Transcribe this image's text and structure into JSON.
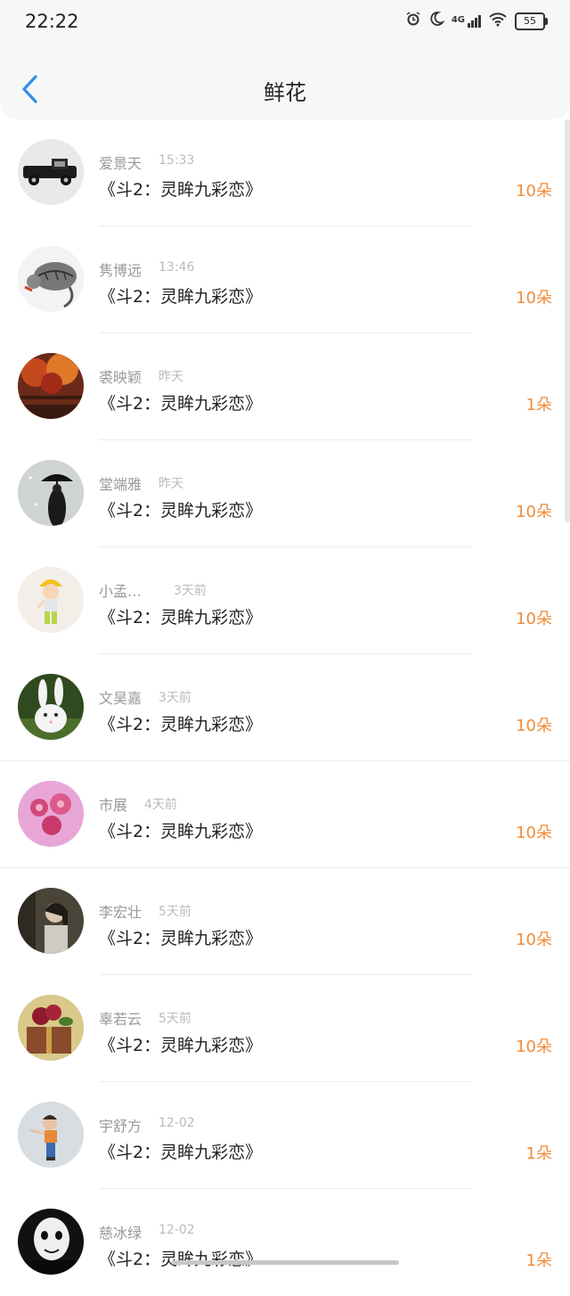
{
  "status": {
    "time": "22:22",
    "signal": "4G",
    "battery": "55"
  },
  "nav": {
    "title": "鲜花"
  },
  "items": [
    {
      "name": "爱景天",
      "time": "15:33",
      "book": "《斗2：灵眸九彩恋》",
      "count": "10朵",
      "avatar": "vintage-car"
    },
    {
      "name": "隽博远",
      "time": "13:46",
      "book": "《斗2：灵眸九彩恋》",
      "count": "10朵",
      "avatar": "cat-sketch"
    },
    {
      "name": "裘映颖",
      "time": "昨天",
      "book": "《斗2：灵眸九彩恋》",
      "count": "1朵",
      "avatar": "autumn-forest"
    },
    {
      "name": "堂端雅",
      "time": "昨天",
      "book": "《斗2：灵眸九彩恋》",
      "count": "10朵",
      "avatar": "umbrella-figure"
    },
    {
      "name": "小孟…",
      "time": "3天前",
      "book": "《斗2：灵眸九彩恋》",
      "count": "10朵",
      "avatar": "cartoon-girl"
    },
    {
      "name": "文昊嘉",
      "time": "3天前",
      "book": "《斗2：灵眸九彩恋》",
      "count": "10朵",
      "avatar": "white-rabbit"
    },
    {
      "name": "市展",
      "time": "4天前",
      "book": "《斗2：灵眸九彩恋》",
      "count": "10朵",
      "avatar": "pink-flowers"
    },
    {
      "name": "李宏壮",
      "time": "5天前",
      "book": "《斗2：灵眸九彩恋》",
      "count": "10朵",
      "avatar": "girl-portrait"
    },
    {
      "name": "辜若云",
      "time": "5天前",
      "book": "《斗2：灵眸九彩恋》",
      "count": "10朵",
      "avatar": "gift-box"
    },
    {
      "name": "宇舒方",
      "time": "12-02",
      "book": "《斗2：灵眸九彩恋》",
      "count": "1朵",
      "avatar": "child-photo"
    },
    {
      "name": "慈冰绿",
      "time": "12-02",
      "book": "《斗2：灵眸九彩恋》",
      "count": "1朵",
      "avatar": "bw-face"
    }
  ]
}
